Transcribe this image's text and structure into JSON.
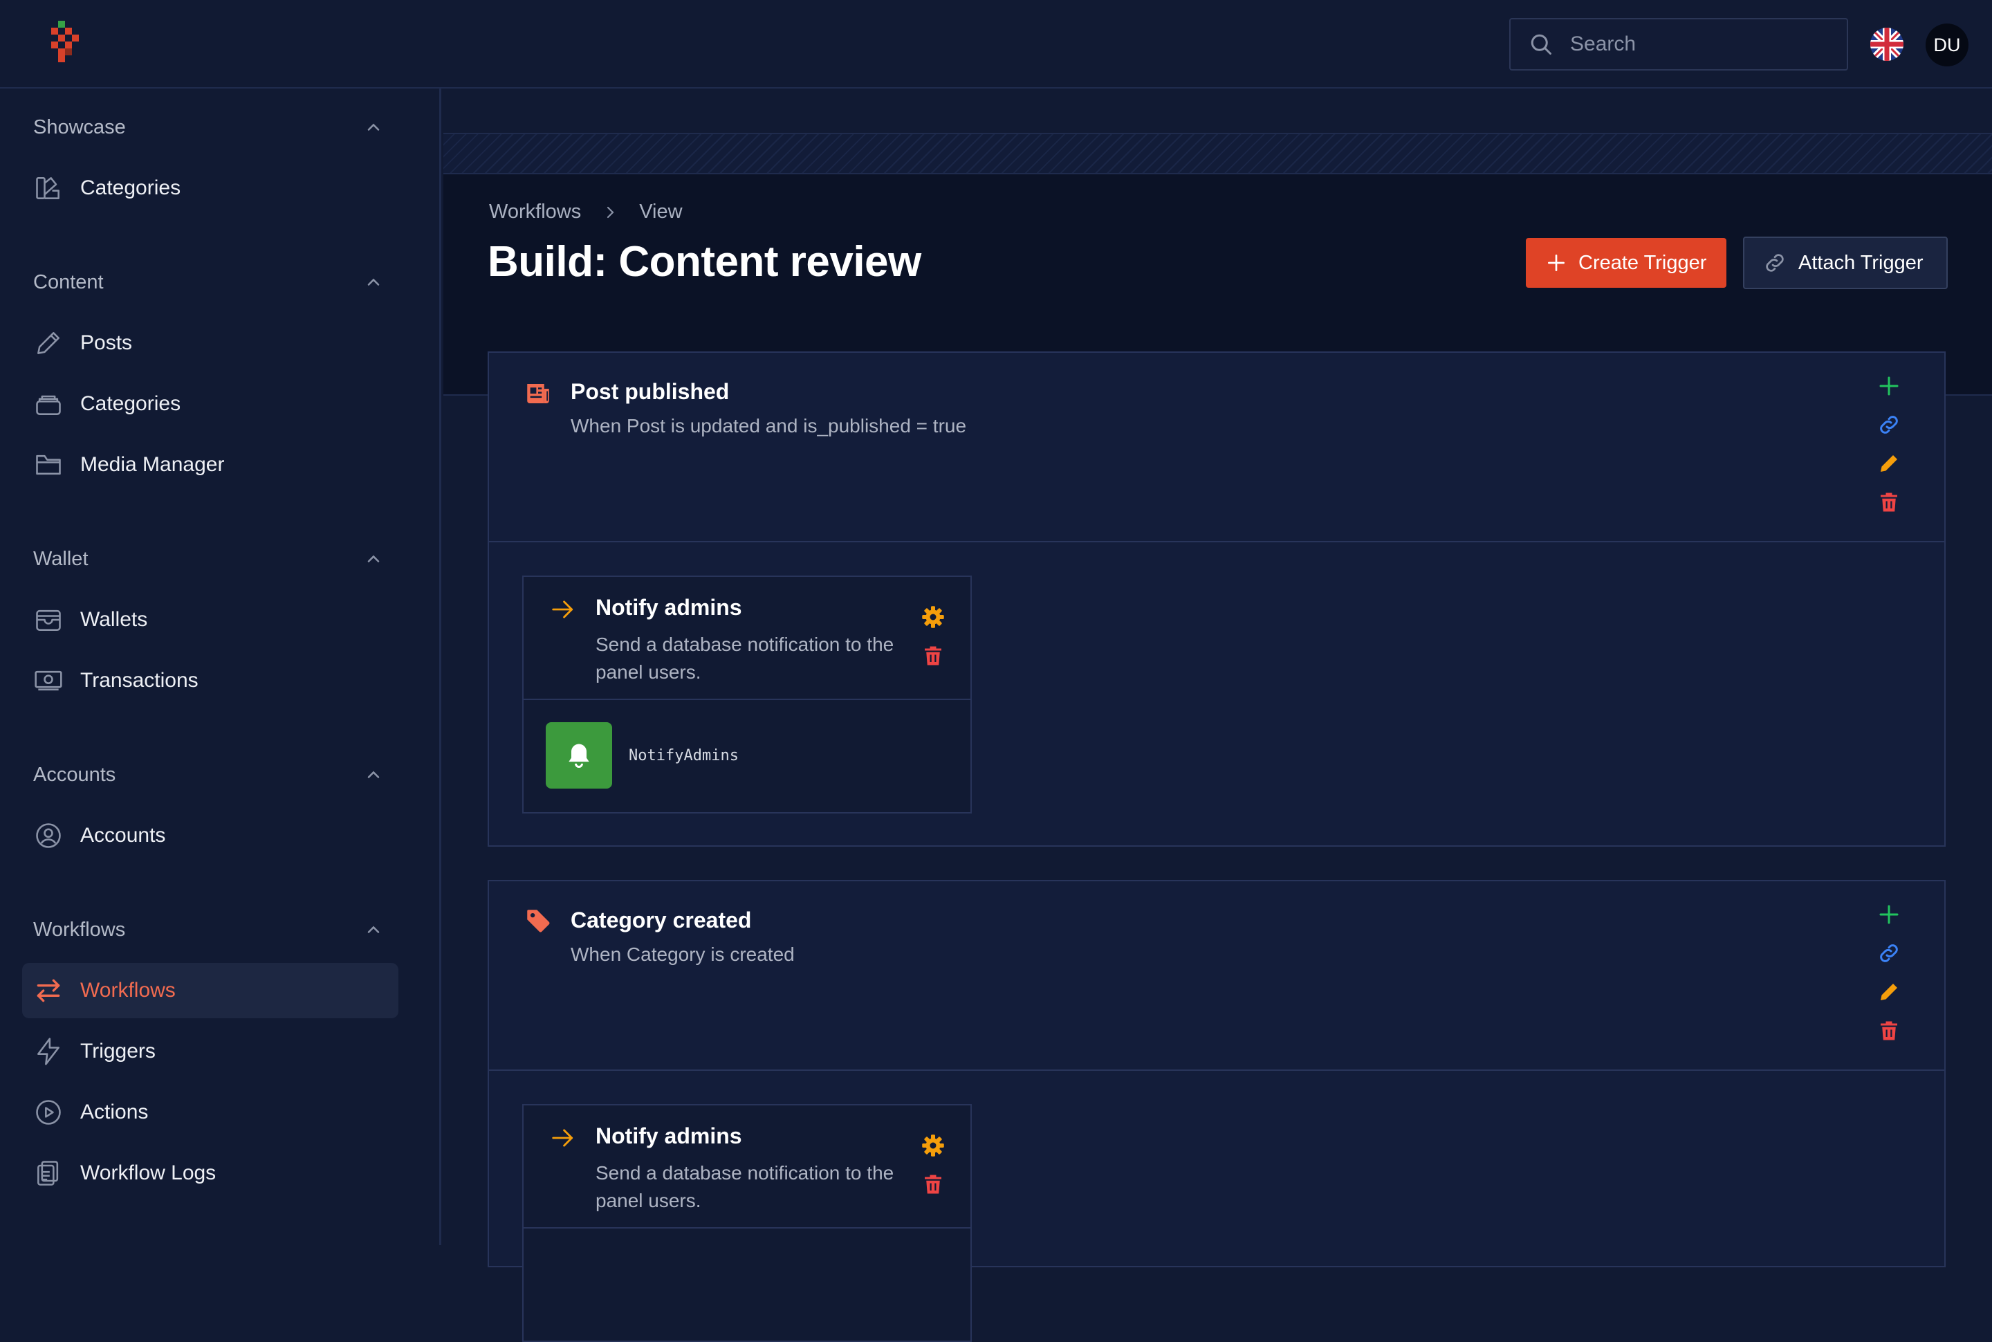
{
  "header": {
    "search_placeholder": "Search",
    "avatar_initials": "DU"
  },
  "sidebar": {
    "groups": [
      {
        "title": "Showcase",
        "items": [
          {
            "label": "Categories",
            "icon": "shapes-icon"
          }
        ]
      },
      {
        "title": "Content",
        "items": [
          {
            "label": "Posts",
            "icon": "pencil-icon"
          },
          {
            "label": "Categories",
            "icon": "stack-icon"
          },
          {
            "label": "Media Manager",
            "icon": "folder-icon"
          }
        ]
      },
      {
        "title": "Wallet",
        "items": [
          {
            "label": "Wallets",
            "icon": "wallet-icon"
          },
          {
            "label": "Transactions",
            "icon": "banknotes-icon"
          }
        ]
      },
      {
        "title": "Accounts",
        "items": [
          {
            "label": "Accounts",
            "icon": "user-circle-icon"
          }
        ]
      },
      {
        "title": "Workflows",
        "items": [
          {
            "label": "Workflows",
            "icon": "arrows-exchange-icon",
            "active": true
          },
          {
            "label": "Triggers",
            "icon": "bolt-icon"
          },
          {
            "label": "Actions",
            "icon": "play-circle-icon"
          },
          {
            "label": "Workflow Logs",
            "icon": "clipboard-icon"
          }
        ]
      }
    ]
  },
  "page": {
    "breadcrumbs": [
      "Workflows",
      "View"
    ],
    "title": "Build: Content review",
    "create_trigger_label": "Create Trigger",
    "attach_trigger_label": "Attach Trigger"
  },
  "triggers": [
    {
      "name": "Post published",
      "description": "When Post is updated and is_published = true",
      "icon": "newspaper-icon",
      "action": {
        "name": "Notify admins",
        "description": "Send a database notification to the panel users.",
        "class": "NotifyAdmins"
      }
    },
    {
      "name": "Category created",
      "description": "When Category is created",
      "icon": "tag-icon",
      "action": {
        "name": "Notify admins",
        "description": "Send a database notification to the panel users."
      }
    }
  ],
  "colors": {
    "accent": "#df4326",
    "active_text": "#f26b50",
    "add": "#22c55e",
    "link": "#3b82f6",
    "edit": "#f59e0b",
    "delete": "#ef4444",
    "bell_bg": "#3c9a3d"
  }
}
